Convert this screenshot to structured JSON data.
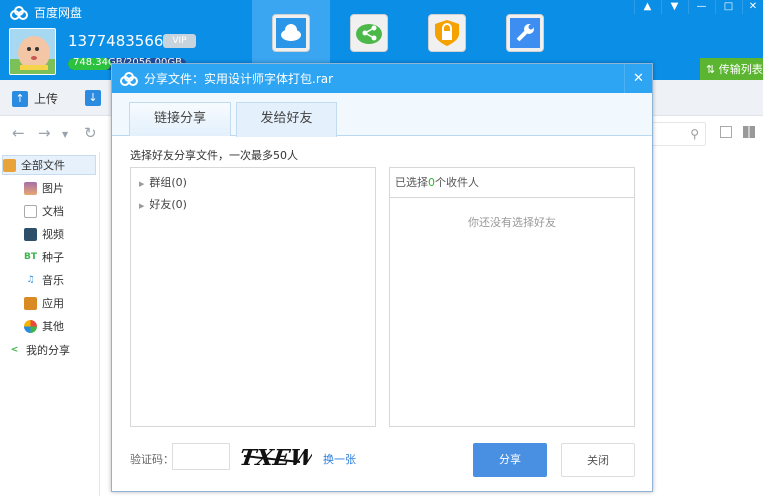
{
  "app": {
    "title": "百度网盘",
    "user_name": "1377483566a",
    "vip_label": "VIP",
    "quota_text": "748.34GB/2056.00GB",
    "quota_fraction": 0.364
  },
  "nav_tabs": [
    {
      "icon": "cloud-icon",
      "active": true
    },
    {
      "icon": "share-icon",
      "active": false
    },
    {
      "icon": "lock-icon",
      "active": false
    },
    {
      "icon": "wrench-icon",
      "active": false
    }
  ],
  "window_buttons": [
    "bell-icon",
    "menu-icon",
    "minimize-icon",
    "maximize-icon",
    "close-icon"
  ],
  "transfer_label": "传输列表",
  "toolbar": {
    "upload": "上传"
  },
  "sidebar": {
    "items": [
      {
        "label": "全部文件",
        "icon": "folder-icon"
      },
      {
        "label": "图片",
        "icon": "image-icon"
      },
      {
        "label": "文档",
        "icon": "document-icon"
      },
      {
        "label": "视频",
        "icon": "video-icon"
      },
      {
        "label": "种子",
        "icon": "bt-icon"
      },
      {
        "label": "音乐",
        "icon": "music-icon"
      },
      {
        "label": "应用",
        "icon": "app-icon"
      },
      {
        "label": "其他",
        "icon": "other-icon"
      },
      {
        "label": "我的分享",
        "icon": "share-icon"
      }
    ]
  },
  "dialog": {
    "title": "分享文件：实用设计师字体打包.rar",
    "tabs": [
      {
        "label": "链接分享"
      },
      {
        "label": "发给好友"
      }
    ],
    "instruction": "选择好友分享文件，一次最多50人",
    "tree": [
      {
        "label": "群组(0)"
      },
      {
        "label": "好友(0)"
      }
    ],
    "selected_prefix": "已选择",
    "selected_count": "0",
    "selected_suffix": "个收件人",
    "empty_text": "你还没有选择好友",
    "captcha_label": "验证码：",
    "captcha_value": "",
    "captcha_image_text": "TXEW",
    "refresh_link": "换一张",
    "share_button": "分享",
    "close_button": "关闭"
  },
  "colors": {
    "brand_blue": "#0a8ee6",
    "dialog_header": "#2da5f3",
    "share_button": "#4a90e2",
    "transfer_green": "#5cb531"
  }
}
